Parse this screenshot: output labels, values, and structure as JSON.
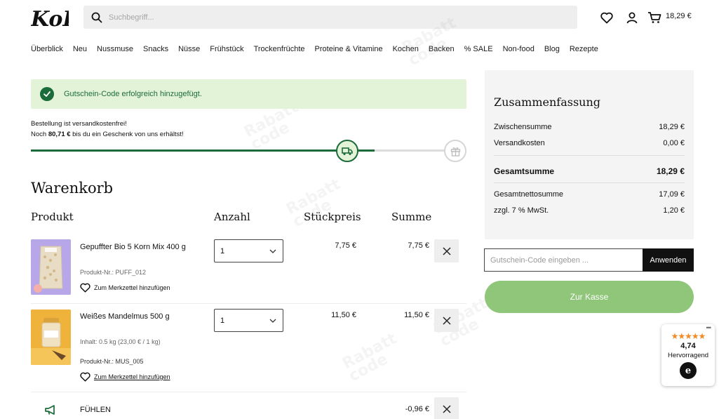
{
  "brand": {
    "logo_text": "KoRo"
  },
  "header": {
    "search_placeholder": "Suchbegriff...",
    "cart_total": "18,29 €"
  },
  "nav": [
    "Überblick",
    "Neu",
    "Nussmuse",
    "Snacks",
    "Nüsse",
    "Frühstück",
    "Trockenfrüchte",
    "Proteine & Vitamine",
    "Kochen",
    "Backen",
    "% SALE",
    "Non-food",
    "Blog",
    "Rezepte"
  ],
  "alert": {
    "message": "Gutschein-Code erfolgreich hinzugefügt."
  },
  "shipping": {
    "line1": "Bestellung ist versandkostenfrei!",
    "line2_prefix": "Noch ",
    "line2_amount": "80,71 €",
    "line2_suffix": " bis du ein Geschenk von uns erhältst!",
    "progress_fraction": 0.83
  },
  "cart": {
    "title": "Warenkorb",
    "columns": {
      "product": "Produkt",
      "qty": "Anzahl",
      "unit_price": "Stückpreis",
      "sum": "Summe"
    },
    "items": [
      {
        "name": "Gepuffter Bio 5 Korn Mix 400 g",
        "info": "",
        "sku": "Produkt-Nr.: PUFF_012",
        "wishlist": "Zum Merkzettel hinzufügen",
        "qty": "1",
        "unit_price": "7,75 €",
        "sum": "7,75 €"
      },
      {
        "name": "Weißes Mandelmus 500 g",
        "info": "Inhalt: 0.5 kg (23,00 € / 1 kg)",
        "sku": "Produkt-Nr.: MUS_005",
        "wishlist": "Zum Merkzettel hinzufügen",
        "qty": "1",
        "unit_price": "11,50 €",
        "sum": "11,50 €"
      }
    ],
    "voucher": {
      "code": "FÜHLEN",
      "sum": "-0,96 €"
    }
  },
  "summary": {
    "title": "Zusammenfassung",
    "subtotal_label": "Zwischensumme",
    "subtotal": "18,29 €",
    "shipping_label": "Versandkosten",
    "shipping": "0,00 €",
    "total_label": "Gesamtsumme",
    "total": "18,29 €",
    "net_label": "Gesamtnettosumme",
    "net": "17,09 €",
    "vat_label": "zzgl. 7 % MwSt.",
    "vat": "1,20 €"
  },
  "coupon": {
    "placeholder": "Gutschein-Code eingeben ...",
    "apply_label": "Anwenden"
  },
  "checkout_label": "Zur Kasse",
  "trust": {
    "rating": "4,74",
    "label": "Hervorragend",
    "stars": "★★★★★",
    "badge": "e"
  },
  "watermark": {
    "line1": "Rabatt",
    "line2": "code"
  },
  "colors": {
    "brand_green": "#1c6b3a",
    "alert_bg": "#e3f3d8",
    "checkout": "#8fc679"
  }
}
